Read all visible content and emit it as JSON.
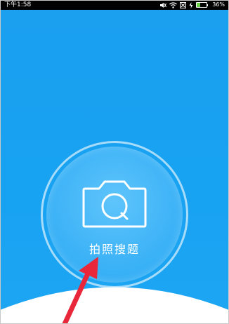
{
  "status_bar": {
    "time": "下午1:58",
    "battery_percent": "36%",
    "battery_level": 0.36,
    "icons": [
      "mute-icon",
      "wifi-icon",
      "sim-icon",
      "charging-icon",
      "battery-icon"
    ]
  },
  "main": {
    "search_button_label": "拍照搜题",
    "search_button_icon": "camera-icon"
  },
  "colors": {
    "background": "#1aa3f0",
    "ring": "#a6dcfa",
    "arrow": "#e8283a",
    "battery_fill": "#6bd34a"
  }
}
